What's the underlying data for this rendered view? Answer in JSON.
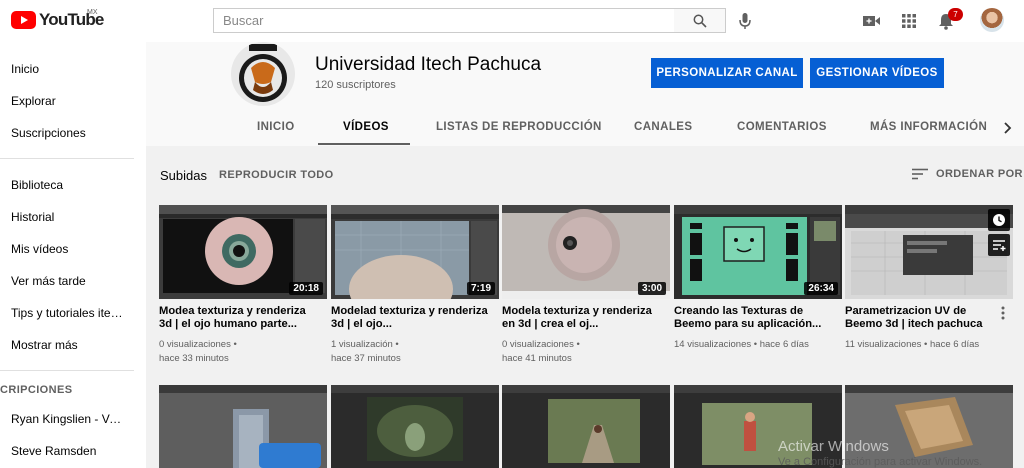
{
  "header": {
    "logo_text": "YouTube",
    "country": "MX",
    "search_placeholder": "Buscar",
    "notification_count": "7"
  },
  "sidebar": {
    "items": [
      "Inicio",
      "Explorar",
      "Suscripciones",
      "Biblioteca",
      "Historial",
      "Mis vídeos",
      "Ver más tarde",
      "Tips y tutoriales itec...",
      "Mostrar más"
    ],
    "section_title": "CRIPCIONES",
    "subscriptions": [
      "Ryan Kingslien - Vert...",
      "Steve Ramsden"
    ]
  },
  "channel": {
    "name": "Universidad Itech Pachuca",
    "subscribers": "120 suscriptores",
    "customize_button": "PERSONALIZAR CANAL",
    "manage_button": "GESTIONAR VÍDEOS",
    "tabs": [
      "INICIO",
      "VÍDEOS",
      "LISTAS DE REPRODUCCIÓN",
      "CANALES",
      "COMENTARIOS",
      "MÁS INFORMACIÓN"
    ],
    "active_tab": "VÍDEOS"
  },
  "content": {
    "section_label": "Subidas",
    "play_all": "REPRODUCIR TODO",
    "sort_label": "ORDENAR POR"
  },
  "videos": [
    {
      "title": "Modea texturiza y renderiza 3d | el ojo humano parte...",
      "duration": "20:18",
      "views": "0 visualizaciones",
      "age": "hace 33 minutos"
    },
    {
      "title": "Modelad texturiza y renderiza 3d | el ojo...",
      "duration": "7:19",
      "views": "1 visualización",
      "age": "hace 37 minutos"
    },
    {
      "title": "Modela texturiza y renderiza en 3d | crea el oj...",
      "duration": "3:00",
      "views": "0 visualizaciones",
      "age": "hace 41 minutos"
    },
    {
      "title": "Creando las Texturas de Beemo para su aplicación...",
      "duration": "26:34",
      "views": "14 visualizaciones",
      "age": "hace 6 días"
    },
    {
      "title": "Parametrizacion UV de Beemo 3d | itech pachuca",
      "duration": "",
      "views": "11 visualizaciones",
      "age": "hace 6 días"
    }
  ],
  "watermark": {
    "line1": "Activar Windows",
    "line2": "Ve a Configuración para activar Windows."
  }
}
